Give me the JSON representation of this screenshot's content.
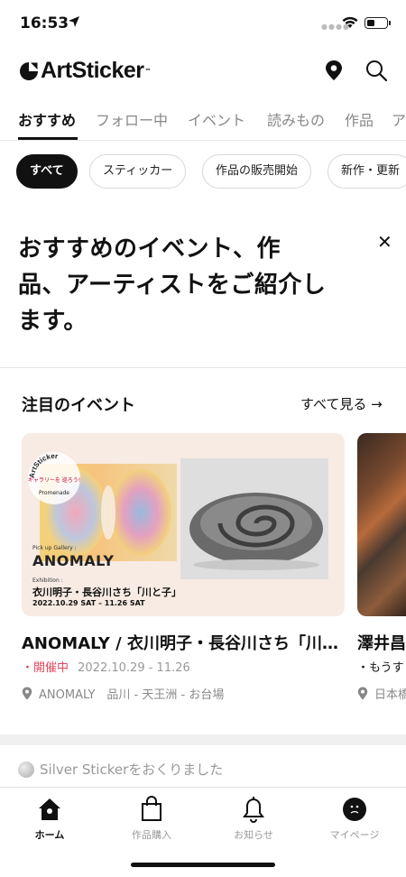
{
  "status_bar": {
    "time": "16:53"
  },
  "header": {
    "logo_text": "ArtSticker",
    "logo_tm": "™"
  },
  "main_tabs": [
    {
      "label": "おすすめ"
    },
    {
      "label": "フォロー中"
    },
    {
      "label": "イベント"
    },
    {
      "label": "読みもの"
    },
    {
      "label": "作品"
    },
    {
      "label": "ア"
    }
  ],
  "filters": [
    {
      "label": "すべて"
    },
    {
      "label": "スティッカー"
    },
    {
      "label": "作品の販売開始"
    },
    {
      "label": "新作・更新"
    }
  ],
  "intro": {
    "line1": "おすすめのイベント、作",
    "line2": "品、アーティストをご紹介し",
    "line3": "ます。"
  },
  "featured": {
    "title": "注目のイベント",
    "see_all": "すべて見る →",
    "poster": {
      "badge_line1": "ArtSticker",
      "badge_line2": "Promenade",
      "badge_inner": "ギャラリーを 巡ろう!",
      "pick_up": "Pick up Gallery :",
      "gallery": "ANOMALY",
      "exhibition_label": "Exhibition :",
      "exhibition_title": "衣川明子・長谷川さち「川と子」",
      "exhibition_date": "2022.10.29 SAT – 11.26 SAT"
    },
    "cards": [
      {
        "title": "ANOMALY / 衣川明子・長谷川さち「川…",
        "status": "・開催中",
        "dates": "2022.10.29 - 11.26",
        "venue": "ANOMALY　品川 - 天王洲 - お台場"
      },
      {
        "title": "澤井昌",
        "status": "・もうす",
        "venue": "日本橋"
      }
    ]
  },
  "notice": {
    "text": "Silver Stickerをおくりました"
  },
  "tab_bar": [
    {
      "label": "ホーム"
    },
    {
      "label": "作品購入"
    },
    {
      "label": "お知らせ"
    },
    {
      "label": "マイページ"
    }
  ],
  "colors": {
    "accent_red": "#e0475a",
    "text": "#111111",
    "muted": "#999999"
  }
}
